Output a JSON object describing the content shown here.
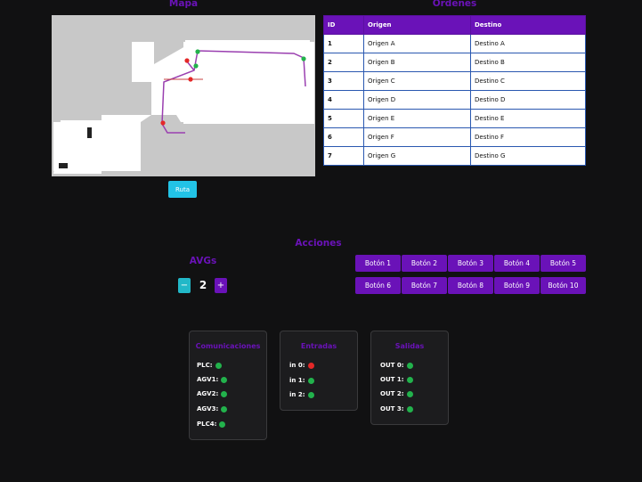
{
  "map": {
    "title": "Mapa",
    "route_button": "Ruta"
  },
  "orders": {
    "title": "Ordenes",
    "columns": [
      "ID",
      "Origen",
      "Destino"
    ],
    "rows": [
      {
        "id": "1",
        "origin": "Origen A",
        "dest": "Destino A"
      },
      {
        "id": "2",
        "origin": "Origen B",
        "dest": "Destino B"
      },
      {
        "id": "3",
        "origin": "Origen C",
        "dest": "Destino C"
      },
      {
        "id": "4",
        "origin": "Origen D",
        "dest": "Destino D"
      },
      {
        "id": "5",
        "origin": "Origen E",
        "dest": "Destino E"
      },
      {
        "id": "6",
        "origin": "Origen F",
        "dest": "Destino F"
      },
      {
        "id": "7",
        "origin": "Origen G",
        "dest": "Destino G"
      }
    ]
  },
  "actions": {
    "title": "Acciones",
    "buttons": [
      "Botón 1",
      "Botón 2",
      "Botón 3",
      "Botón 4",
      "Botón 5",
      "Botón 6",
      "Botón 7",
      "Botón 8",
      "Botón 9",
      "Botón 10"
    ]
  },
  "avgs": {
    "title": "AVGs",
    "minus": "−",
    "plus": "+",
    "count": "2"
  },
  "panels": {
    "comunicaciones": {
      "title": "Comunicaciones",
      "items": [
        {
          "label": "PLC:",
          "status": "ok"
        },
        {
          "label": "AGV1:",
          "status": "ok"
        },
        {
          "label": "AGV2:",
          "status": "ok"
        },
        {
          "label": "AGV3:",
          "status": "ok"
        },
        {
          "label": "PLC4:",
          "status": "ok"
        }
      ]
    },
    "entradas": {
      "title": "Entradas",
      "items": [
        {
          "label": "in 0:",
          "status": "error"
        },
        {
          "label": "in 1:",
          "status": "ok"
        },
        {
          "label": "in 2:",
          "status": "ok"
        }
      ]
    },
    "salidas": {
      "title": "Salidas",
      "items": [
        {
          "label": "OUT 0:",
          "status": "ok"
        },
        {
          "label": "OUT 1:",
          "status": "ok"
        },
        {
          "label": "OUT 2:",
          "status": "ok"
        },
        {
          "label": "OUT 3:",
          "status": "ok"
        }
      ]
    }
  },
  "colors": {
    "accent": "#6a12b8",
    "ok": "#22b24c",
    "error": "#e42828",
    "route": "#9a3fb0"
  }
}
